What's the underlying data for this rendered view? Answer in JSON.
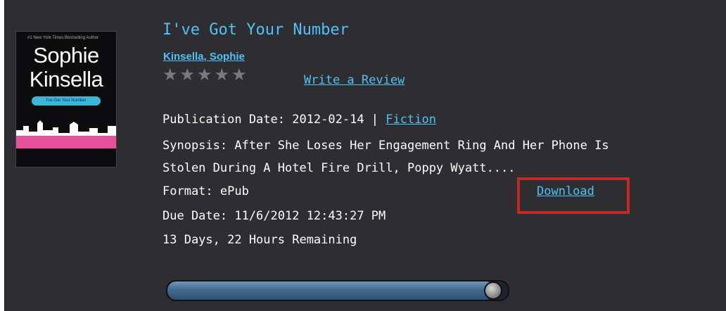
{
  "book": {
    "cover": {
      "tagline": "#1 New York Times Bestselling Author",
      "author_first": "Sophie",
      "author_last": "Kinsella",
      "badge": "I've Got Your Number"
    },
    "title": "I've Got Your Number",
    "author": "Kinsella, Sophie",
    "rating": {
      "stars_total": 5,
      "stars_filled": 0
    },
    "review_link": "Write a Review",
    "publication_label": "Publication Date: 2012-02-14 | ",
    "genre": "Fiction",
    "synopsis_line1": "Synopsis: After She Loses Her Engagement Ring And Her Phone Is",
    "synopsis_line2": "Stolen During A Hotel Fire Drill, Poppy Wyatt....",
    "format": "Format: ePub",
    "due_date": "Due Date: 11/6/2012 12:43:27 PM",
    "remaining": "13 Days, 22 Hours Remaining",
    "download_label": "Download",
    "progress_percent": 96
  },
  "colors": {
    "background": "#2d2d32",
    "link": "#4fc3f7",
    "text": "#ffffff",
    "star": "#7a7a7e",
    "highlight": "#c62828"
  }
}
